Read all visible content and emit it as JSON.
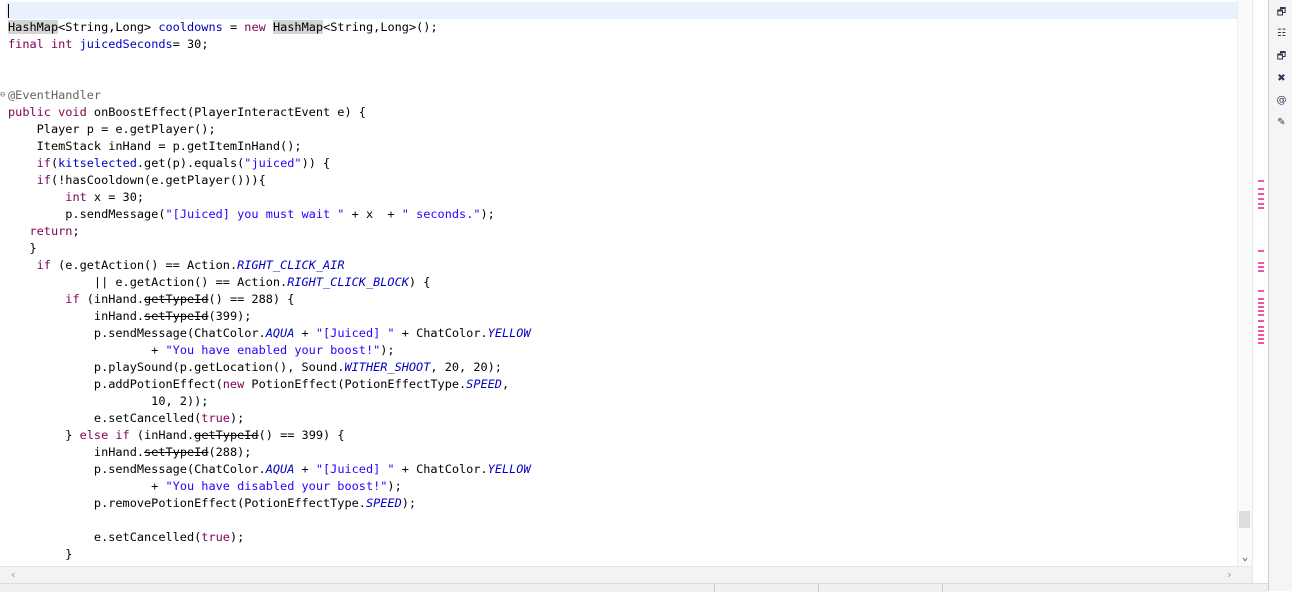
{
  "editor": {
    "lines": [
      {
        "segs": []
      },
      {
        "segs": [
          {
            "t": "HashMap",
            "c": "hl"
          },
          {
            "t": "<String,Long> "
          },
          {
            "t": "cooldowns",
            "c": "fld"
          },
          {
            "t": " = "
          },
          {
            "t": "new",
            "c": "kw"
          },
          {
            "t": " "
          },
          {
            "t": "HashMap",
            "c": "hl"
          },
          {
            "t": "<String,Long>();"
          }
        ]
      },
      {
        "segs": [
          {
            "t": "final int",
            "c": "kw"
          },
          {
            "t": " "
          },
          {
            "t": "juicedSeconds",
            "c": "fld"
          },
          {
            "t": "= 30;"
          }
        ]
      },
      {
        "segs": []
      },
      {
        "segs": []
      },
      {
        "segs": [
          {
            "t": "@EventHandler",
            "c": "ann"
          }
        ]
      },
      {
        "segs": [
          {
            "t": "public void",
            "c": "kw"
          },
          {
            "t": " onBoostEffect(PlayerInteractEvent e) {"
          }
        ]
      },
      {
        "segs": [
          {
            "t": "    Player p = e.getPlayer();"
          }
        ]
      },
      {
        "segs": [
          {
            "t": "    ItemStack inHand = p.getItemInHand();"
          }
        ]
      },
      {
        "segs": [
          {
            "t": "    "
          },
          {
            "t": "if",
            "c": "kw"
          },
          {
            "t": "("
          },
          {
            "t": "kitselected",
            "c": "fld"
          },
          {
            "t": ".get(p).equals("
          },
          {
            "t": "\"juiced\"",
            "c": "str"
          },
          {
            "t": ")) {"
          }
        ]
      },
      {
        "segs": [
          {
            "t": "    "
          },
          {
            "t": "if",
            "c": "kw"
          },
          {
            "t": "(!hasCooldown(e.getPlayer())){"
          }
        ]
      },
      {
        "segs": [
          {
            "t": "        "
          },
          {
            "t": "int",
            "c": "kw"
          },
          {
            "t": " x = 30;"
          }
        ]
      },
      {
        "segs": [
          {
            "t": "        p.sendMessage("
          },
          {
            "t": "\"[Juiced] you must wait \"",
            "c": "str"
          },
          {
            "t": " + x  + "
          },
          {
            "t": "\" seconds.\"",
            "c": "str"
          },
          {
            "t": ");"
          }
        ]
      },
      {
        "segs": [
          {
            "t": "   "
          },
          {
            "t": "return",
            "c": "kw"
          },
          {
            "t": ";"
          }
        ]
      },
      {
        "segs": [
          {
            "t": "   }"
          }
        ]
      },
      {
        "segs": [
          {
            "t": "    "
          },
          {
            "t": "if",
            "c": "kw"
          },
          {
            "t": " (e.getAction() == Action."
          },
          {
            "t": "RIGHT_CLICK_AIR",
            "c": "sf"
          }
        ]
      },
      {
        "segs": [
          {
            "t": "            || e.getAction() == Action."
          },
          {
            "t": "RIGHT_CLICK_BLOCK",
            "c": "sf"
          },
          {
            "t": ") {"
          }
        ]
      },
      {
        "segs": [
          {
            "t": "        "
          },
          {
            "t": "if",
            "c": "kw"
          },
          {
            "t": " (inHand."
          },
          {
            "t": "getTypeId",
            "c": "dep"
          },
          {
            "t": "() == 288) {"
          }
        ]
      },
      {
        "segs": [
          {
            "t": "            inHand."
          },
          {
            "t": "setTypeId",
            "c": "dep"
          },
          {
            "t": "(399);"
          }
        ]
      },
      {
        "segs": [
          {
            "t": "            p.sendMessage(ChatColor."
          },
          {
            "t": "AQUA",
            "c": "sf"
          },
          {
            "t": " + "
          },
          {
            "t": "\"[Juiced] \"",
            "c": "str"
          },
          {
            "t": " + ChatColor."
          },
          {
            "t": "YELLOW",
            "c": "sf"
          }
        ]
      },
      {
        "segs": [
          {
            "t": "                    + "
          },
          {
            "t": "\"You have enabled your boost!\"",
            "c": "str"
          },
          {
            "t": ");"
          }
        ]
      },
      {
        "segs": [
          {
            "t": "            p.playSound(p.getLocation(), Sound."
          },
          {
            "t": "WITHER_SHOOT",
            "c": "sf"
          },
          {
            "t": ", 20, 20);"
          }
        ]
      },
      {
        "segs": [
          {
            "t": "            p.addPotionEffect("
          },
          {
            "t": "new",
            "c": "kw"
          },
          {
            "t": " PotionEffect(PotionEffectType."
          },
          {
            "t": "SPEED",
            "c": "sf"
          },
          {
            "t": ","
          }
        ]
      },
      {
        "segs": [
          {
            "t": "                    10, 2));"
          }
        ]
      },
      {
        "segs": [
          {
            "t": "            e.setCancelled("
          },
          {
            "t": "true",
            "c": "kw"
          },
          {
            "t": ");"
          }
        ]
      },
      {
        "segs": [
          {
            "t": "        } "
          },
          {
            "t": "else if",
            "c": "kw"
          },
          {
            "t": " (inHand."
          },
          {
            "t": "getTypeId",
            "c": "dep"
          },
          {
            "t": "() == 399) {"
          }
        ]
      },
      {
        "segs": [
          {
            "t": "            inHand."
          },
          {
            "t": "setTypeId",
            "c": "dep"
          },
          {
            "t": "(288);"
          }
        ]
      },
      {
        "segs": [
          {
            "t": "            p.sendMessage(ChatColor."
          },
          {
            "t": "AQUA",
            "c": "sf"
          },
          {
            "t": " + "
          },
          {
            "t": "\"[Juiced] \"",
            "c": "str"
          },
          {
            "t": " + ChatColor."
          },
          {
            "t": "YELLOW",
            "c": "sf"
          }
        ]
      },
      {
        "segs": [
          {
            "t": "                    + "
          },
          {
            "t": "\"You have disabled your boost!\"",
            "c": "str"
          },
          {
            "t": ");"
          }
        ]
      },
      {
        "segs": [
          {
            "t": "            p.removePotionEffect(PotionEffectType."
          },
          {
            "t": "SPEED",
            "c": "sf"
          },
          {
            "t": ");"
          }
        ]
      },
      {
        "segs": []
      },
      {
        "segs": [
          {
            "t": "            e.setCancelled("
          },
          {
            "t": "true",
            "c": "kw"
          },
          {
            "t": ");"
          }
        ]
      },
      {
        "segs": [
          {
            "t": "        }"
          }
        ]
      }
    ]
  },
  "scrollbars": {
    "down_arrow": "⌄",
    "left_arrow": "‹",
    "right_arrow": "›"
  },
  "right_toolbar": [
    {
      "icon": "restore-icon",
      "glyph": "🗗"
    },
    {
      "icon": "outline-icon",
      "glyph": "☷"
    },
    {
      "icon": "restore-icon",
      "glyph": "🗗"
    },
    {
      "icon": "error-log-icon",
      "glyph": "✖"
    },
    {
      "icon": "at-sign-icon",
      "glyph": "@"
    },
    {
      "icon": "javadoc-icon",
      "glyph": "✎"
    }
  ],
  "colors": {
    "keyword": "#7f0055",
    "string": "#2a00ff",
    "field": "#0000c0",
    "annotation": "#646464",
    "current_line": "#e8f2fe",
    "occurrence_marker": "#e85aa6"
  }
}
